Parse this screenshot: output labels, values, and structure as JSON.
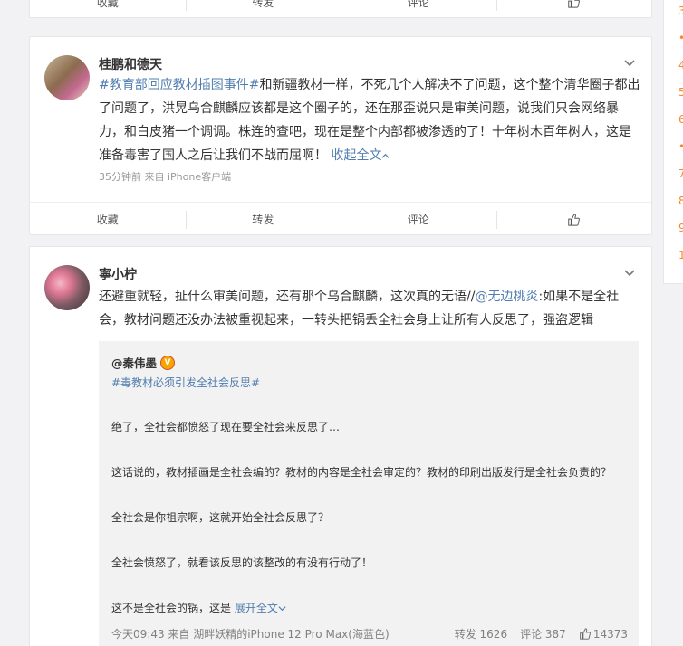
{
  "action_labels": {
    "favorite": "收藏",
    "repost": "转发",
    "comment": "评论"
  },
  "post1": {
    "author": "桂鹏和德天",
    "hashtag": "#教育部回应教材插图事件#",
    "text": "和新疆教材一样，不死几个人解决不了问题，这个整个清华圈子都出了问题了，洪晃乌合麒麟应该都是这个圈子的，还在那歪说只是审美问题，说我们只会网络暴力，和白皮猪一个调调。株连的查吧，现在是整个内部都被渗透的了！十年树木百年树人，这是准备毒害了国人之后让我们不战而屈啊！",
    "collapse_label": "收起全文",
    "meta": "35分钟前  来自 iPhone客户端"
  },
  "post2": {
    "author": "寧小柠",
    "text_before": "还避重就轻，扯什么审美问题，还有那个乌合麒麟，这次真的无语//",
    "mention": "@无边桃炎",
    "text_after": ":如果不是全社会，教材问题还没办法被重视起来，一转头把锅丢全社会身上让所有人反思了，强盗逻辑",
    "repost": {
      "author": "@秦伟墨",
      "hashtag": "#毒教材必须引发全社会反思#",
      "paragraphs": [
        "绝了，全社会都愤怒了现在要全社会来反思了…",
        "这话说的，教材插画是全社会编的？教材的内容是全社会审定的？教材的印刷出版发行是全社会负责的？",
        "全社会是你祖宗啊，这就开始全社会反思了？",
        "全社会愤怒了，就看该反思的该整改的有没有行动了！",
        "这不是全社会的锅，这是"
      ],
      "expand_label": "展开全文",
      "meta": "今天09:43 来自 湖畔妖精的iPhone 12 Pro Max(海蓝色)",
      "repost_count": "转发 1626",
      "comment_count": "评论 387",
      "like_count": "14373"
    }
  },
  "right_rail_items": [
    "3",
    "•",
    "4",
    "5",
    "6",
    "•",
    "7",
    "8",
    "9",
    "1"
  ]
}
